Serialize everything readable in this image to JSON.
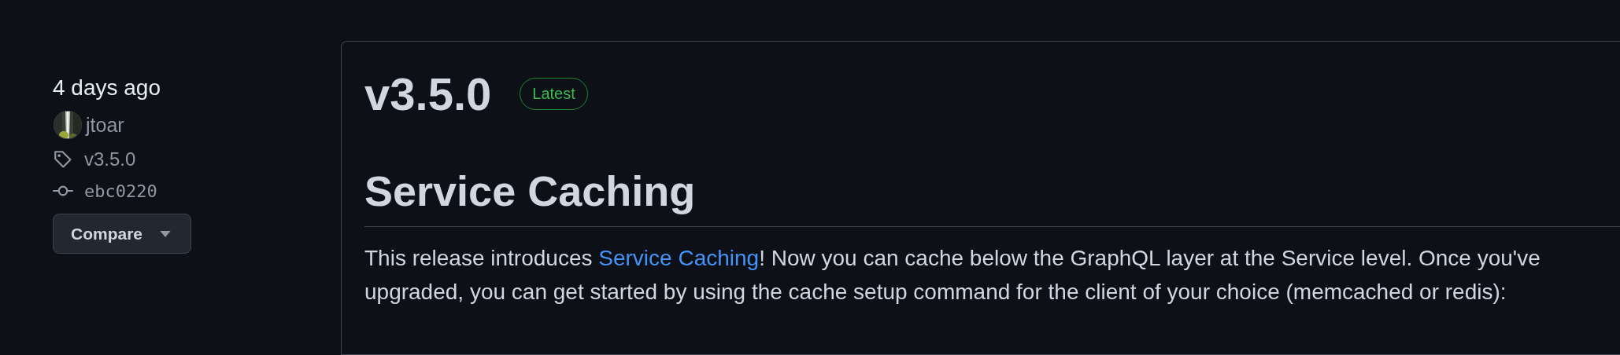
{
  "sidebar": {
    "date": "4 days ago",
    "author": {
      "name": "jtoar"
    },
    "tag": "v3.5.0",
    "commit": "ebc0220",
    "compare_button": "Compare"
  },
  "release": {
    "title": "v3.5.0",
    "badge": "Latest",
    "heading": "Service Caching",
    "paragraph": {
      "before": "This release introduces ",
      "link": "Service Caching",
      "after": "! Now you can cache below the GraphQL layer at the Service level. Once you've upgraded, you can get started by using the cache setup command for the client of your choice (memcached or redis):"
    }
  }
}
